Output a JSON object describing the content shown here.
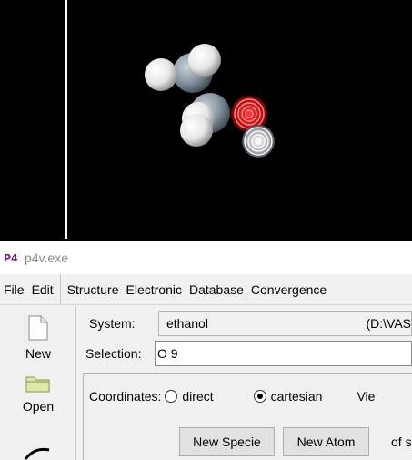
{
  "viewport": {
    "background": "#000000",
    "atoms": {
      "carbon_color": "#8a9aa6",
      "hydrogen_color": "#f2f2f2",
      "oxygen_selected_color": "#e01818",
      "selected_marker_color": "#ffffff"
    }
  },
  "window": {
    "icon_text": "P4",
    "title": "p4v.exe"
  },
  "menu": {
    "items": [
      "File",
      "Edit",
      "Structure",
      "Electronic",
      "Database",
      "Convergence"
    ]
  },
  "toolbar": {
    "new_label": "New",
    "open_label": "Open"
  },
  "form": {
    "system_label": "System:",
    "system_value": "ethanol",
    "system_path": "(D:\\VAS",
    "selection_label": "Selection:",
    "selection_value": "O 9",
    "coordinates_label": "Coordinates:",
    "direct_label": "direct",
    "cartesian_label": "cartesian",
    "coordinates_selected": "cartesian",
    "view_label": "Vie",
    "new_specie_label": "New Specie",
    "new_atom_label": "New Atom",
    "of_text": "of s"
  }
}
